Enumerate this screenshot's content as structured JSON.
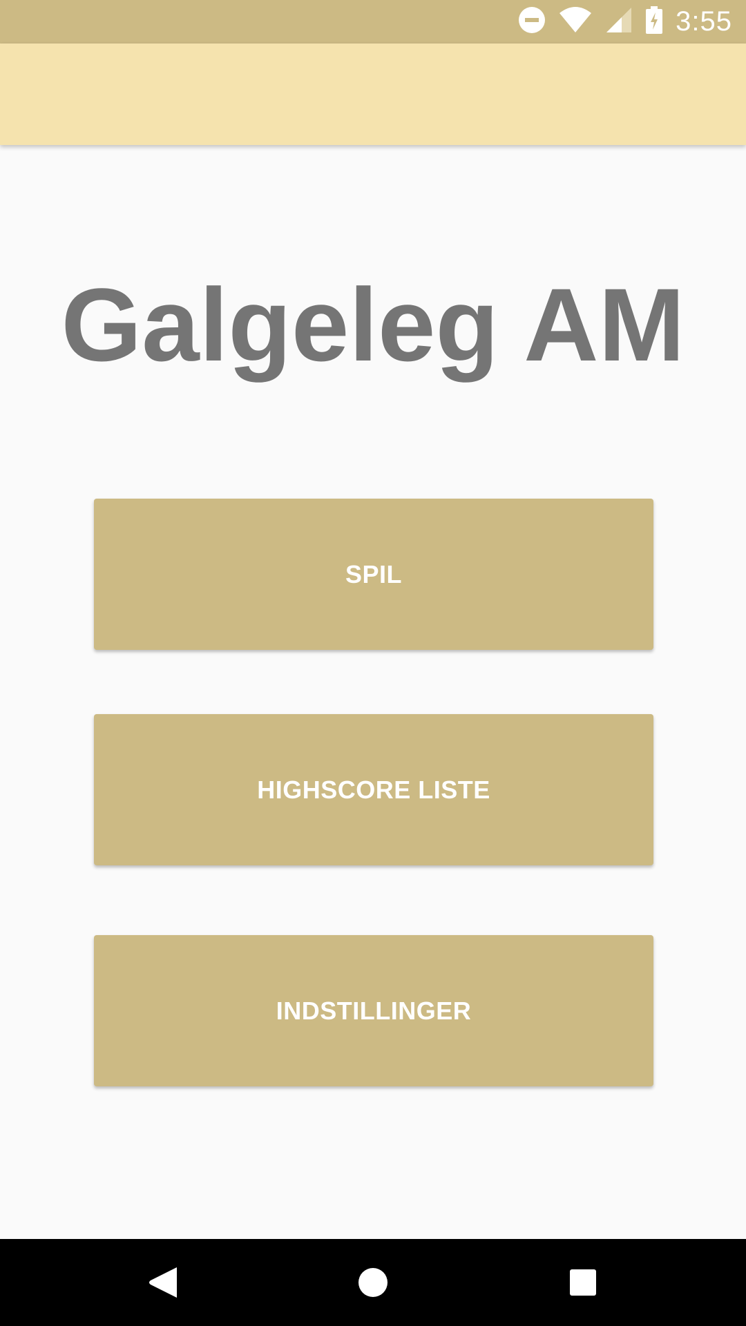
{
  "status_bar": {
    "time": "3:55",
    "icons": [
      "do-not-disturb-icon",
      "wifi-icon",
      "cellular-signal-icon",
      "battery-charging-icon"
    ],
    "background_color": "#CCBA84"
  },
  "app_bar": {
    "background_color": "#F5E3AE"
  },
  "main": {
    "title": "Galgeleg AM",
    "buttons": [
      {
        "label": "SPIL"
      },
      {
        "label": "HIGHSCORE LISTE"
      },
      {
        "label": "INDSTILLINGER"
      }
    ],
    "button_color": "#CCBA84",
    "title_color": "#757575"
  },
  "nav_bar": {
    "icons": [
      "back-icon",
      "home-icon",
      "recents-icon"
    ]
  }
}
